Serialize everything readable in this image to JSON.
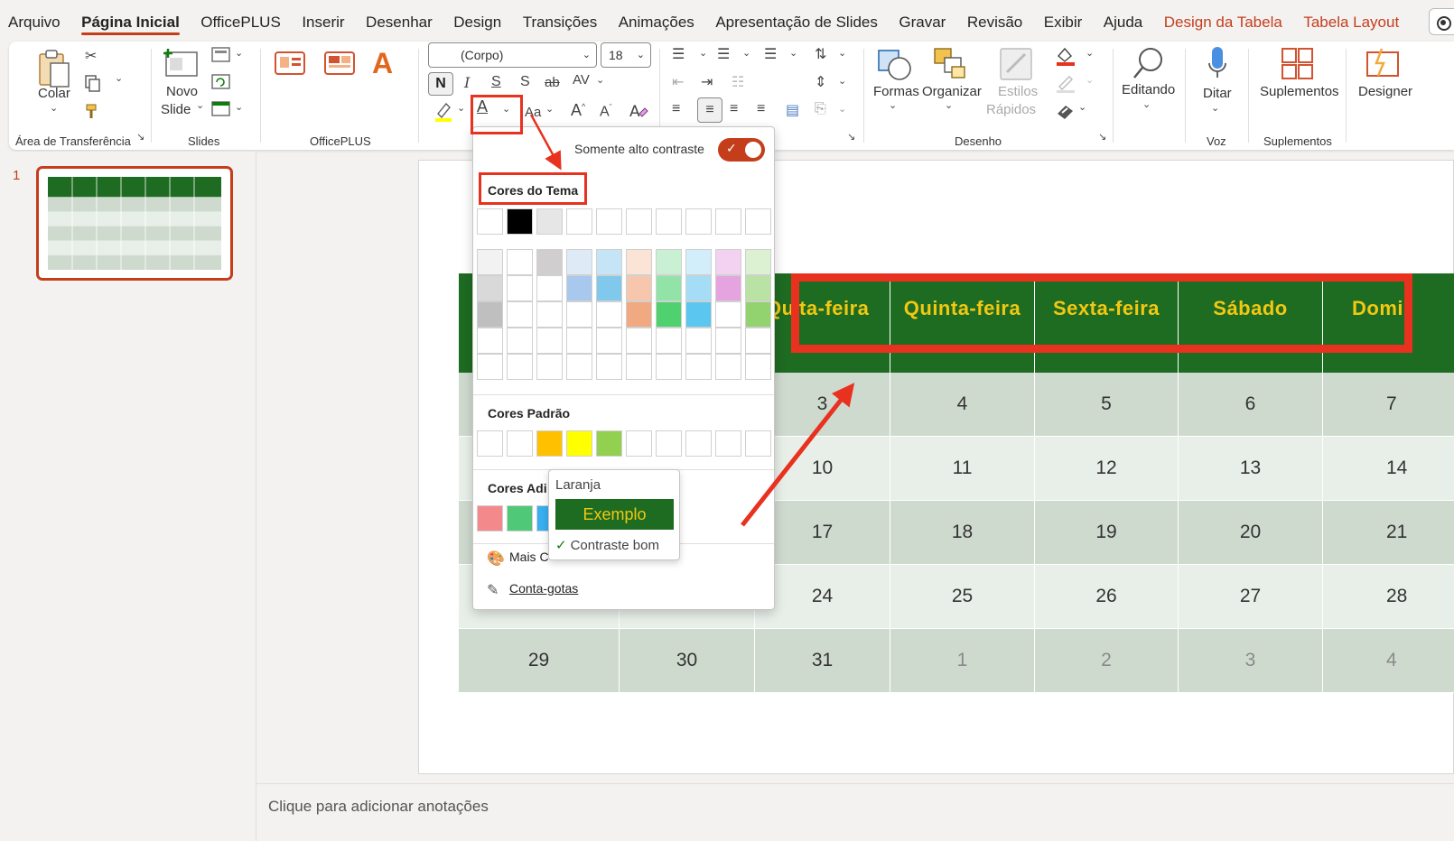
{
  "menu": {
    "tabs": [
      "Arquivo",
      "Página Inicial",
      "OfficePLUS",
      "Inserir",
      "Desenhar",
      "Design",
      "Transições",
      "Animações",
      "Apresentação de Slides",
      "Gravar",
      "Revisão",
      "Exibir",
      "Ajuda",
      "Design da Tabela",
      "Tabela Layout"
    ],
    "active": "Página Inicial",
    "contextual": [
      "Design da Tabela",
      "Tabela Layout"
    ]
  },
  "ribbon": {
    "clipboard": {
      "paste_label": "Colar",
      "group_label": "Área de Transferência"
    },
    "slides": {
      "new_slide_label_1": "Novo",
      "new_slide_label_2": "Slide",
      "group_label": "Slides"
    },
    "officeplus": {
      "group_label": "OfficePLUS"
    },
    "font": {
      "font_name": "(Corpo)",
      "font_size": "18",
      "bold": "N",
      "italic": "I",
      "underline": "S",
      "shadow": "S",
      "strike": "ab",
      "spacing": "AV",
      "change_case": "Aa",
      "grow": "A",
      "shrink": "A"
    },
    "drawing": {
      "shapes_label": "Formas",
      "arrange_label": "Organizar",
      "styles_label_1": "Estilos",
      "styles_label_2": "Rápidos",
      "group_label": "Desenho"
    },
    "editing": {
      "label": "Editando"
    },
    "voice": {
      "dictate_label": "Ditar",
      "group_label": "Voz"
    },
    "addins": {
      "label": "Suplementos",
      "group_label": "Suplementos"
    },
    "designer": {
      "label": "Designer"
    }
  },
  "thumbnail": {
    "number": "1"
  },
  "calendar": {
    "headers": [
      "Qu",
      "rta-feira",
      "Quinta-feira",
      "Sexta-feira",
      "Sábado",
      "Domi"
    ],
    "rows": [
      [
        "",
        "",
        "3",
        "4",
        "5",
        "6",
        "7"
      ],
      [
        "",
        "",
        "10",
        "11",
        "12",
        "13",
        "14"
      ],
      [
        "",
        "",
        "17",
        "18",
        "19",
        "20",
        "21"
      ],
      [
        "",
        "",
        "24",
        "25",
        "26",
        "27",
        "28"
      ],
      [
        "29",
        "30",
        "31",
        "1",
        "2",
        "3",
        "4"
      ]
    ]
  },
  "color_dropdown": {
    "high_contrast_label": "Somente alto contraste",
    "theme_colors_label": "Cores do Tema",
    "standard_colors_label": "Cores Padrão",
    "additional_colors_label": "Cores Adi",
    "more_colors_label": "Mais C",
    "eyedropper_label": "Conta-gotas",
    "theme_top_row": [
      "#ffffff",
      "#000000",
      "#e7e6e6",
      "#ffffff",
      "#ffffff",
      "#ffffff",
      "#ffffff",
      "#ffffff",
      "#ffffff",
      "#ffffff"
    ],
    "theme_columns": [
      [
        "#f2f2f2",
        "#d9d9d9",
        "#bfbfbf",
        "#ffffff",
        "#ffffff"
      ],
      [
        "#ffffff",
        "#ffffff",
        "#ffffff",
        "#ffffff",
        "#ffffff"
      ],
      [
        "#d0cece",
        "#ffffff",
        "#ffffff",
        "#ffffff",
        "#ffffff"
      ],
      [
        "#deeaf6",
        "#a9c8ee",
        "#ffffff",
        "#ffffff",
        "#ffffff"
      ],
      [
        "#c5e4f5",
        "#80c9ec",
        "#ffffff",
        "#ffffff",
        "#ffffff"
      ],
      [
        "#fbe3d6",
        "#f7c7ad",
        "#f1a982",
        "#ffffff",
        "#ffffff"
      ],
      [
        "#c9f0d3",
        "#92e3a8",
        "#4fd16f",
        "#ffffff",
        "#ffffff"
      ],
      [
        "#d2eefb",
        "#a5ddf6",
        "#5bc6ef",
        "#ffffff",
        "#ffffff"
      ],
      [
        "#f2d2f0",
        "#e5a4df",
        "#ffffff",
        "#ffffff",
        "#ffffff"
      ],
      [
        "#dcf1d2",
        "#b8e3a5",
        "#92d36f",
        "#ffffff",
        "#ffffff"
      ]
    ],
    "standard": [
      "#ffffff",
      "#ffffff",
      "#ffc000",
      "#ffff00",
      "#92d050",
      "#ffffff",
      "#ffffff",
      "#ffffff",
      "#ffffff",
      "#ffffff"
    ],
    "additional": [
      "#f4898c",
      "#4fc878",
      "#39aef0"
    ]
  },
  "tooltip": {
    "title": "Laranja",
    "sample": "Exemplo",
    "note": "Contraste bom"
  },
  "notes": {
    "placeholder": "Clique para adicionar anotações"
  },
  "colors": {
    "accent": "#c43e1c",
    "table_header": "#1e6b22",
    "header_text": "#f2c811",
    "annotation_red": "#e8321f"
  }
}
